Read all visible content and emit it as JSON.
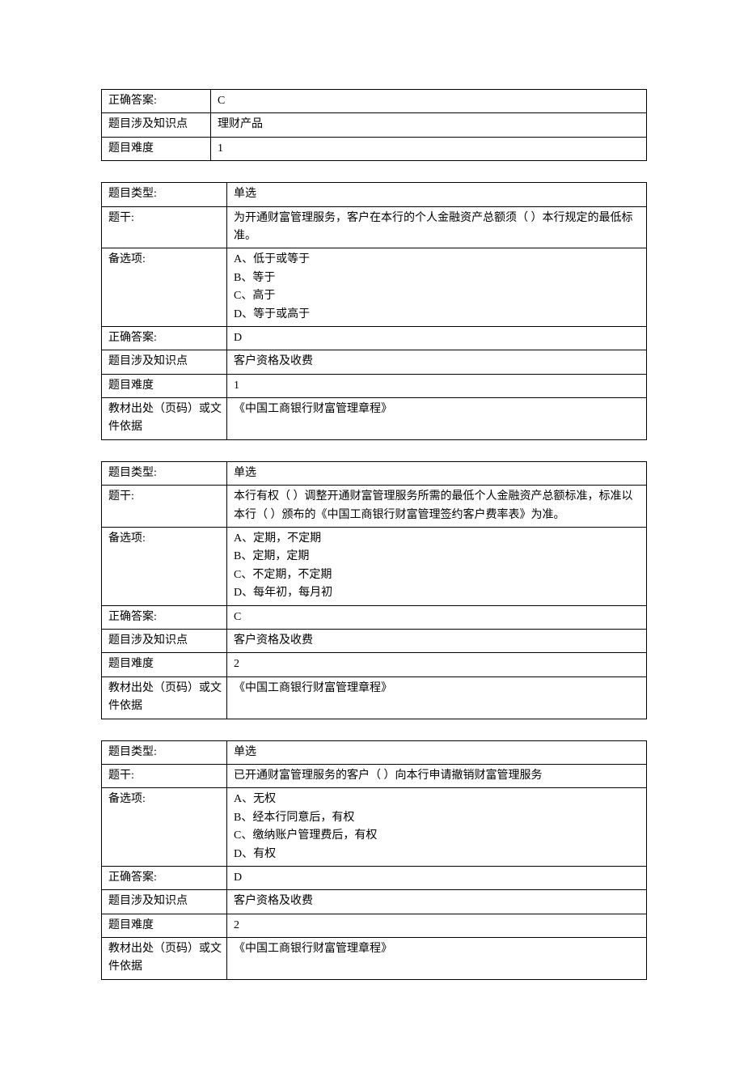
{
  "table1": {
    "answer_label": "正确答案:",
    "answer_value": "C",
    "topic_label": "题目涉及知识点",
    "topic_value": "理财产品",
    "difficulty_label": "题目难度",
    "difficulty_value": "1"
  },
  "table2": {
    "type_label": "题目类型:",
    "type_value": "单选",
    "stem_label": "题干:",
    "stem_value": "为开通财富管理服务，客户在本行的个人金融资产总额须（    ）本行规定的最低标准。",
    "options_label": "备选项:",
    "options_value": "A、低于或等于\nB、等于\nC、高于\nD、等于或高于",
    "answer_label": "正确答案:",
    "answer_value": "D",
    "topic_label": "题目涉及知识点",
    "topic_value": "客户资格及收费",
    "difficulty_label": "题目难度",
    "difficulty_value": "1",
    "source_label": "教材出处（页码）或文件依据",
    "source_value": "《中国工商银行财富管理章程》"
  },
  "table3": {
    "type_label": "题目类型:",
    "type_value": "单选",
    "stem_label": "题干:",
    "stem_value": "本行有权（    ）调整开通财富管理服务所需的最低个人金融资产总额标准，标准以本行（    ）颁布的《中国工商银行财富管理签约客户费率表》为准。",
    "options_label": "备选项:",
    "options_value": "A、定期，不定期\nB、定期，定期\nC、不定期，不定期\nD、每年初，每月初",
    "answer_label": "正确答案:",
    "answer_value": "C",
    "topic_label": "题目涉及知识点",
    "topic_value": "客户资格及收费",
    "difficulty_label": "题目难度",
    "difficulty_value": "2",
    "source_label": "教材出处（页码）或文件依据",
    "source_value": "《中国工商银行财富管理章程》"
  },
  "table4": {
    "type_label": "题目类型:",
    "type_value": "单选",
    "stem_label": "题干:",
    "stem_value": "已开通财富管理服务的客户（    ）向本行申请撤销财富管理服务",
    "options_label": "备选项:",
    "options_value": "A、无权\nB、经本行同意后，有权\nC、缴纳账户管理费后，有权\nD、有权",
    "answer_label": "正确答案:",
    "answer_value": "D",
    "topic_label": "题目涉及知识点",
    "topic_value": "客户资格及收费",
    "difficulty_label": "题目难度",
    "difficulty_value": "2",
    "source_label": "教材出处（页码）或文件依据",
    "source_value": "《中国工商银行财富管理章程》"
  }
}
